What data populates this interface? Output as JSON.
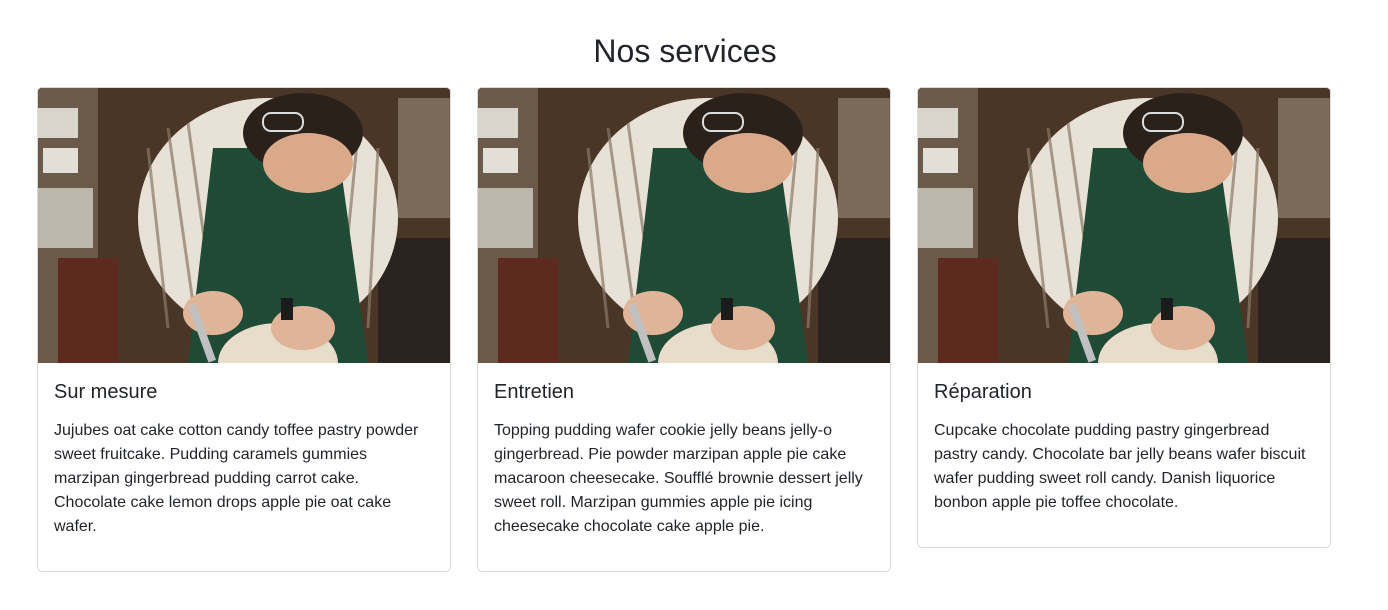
{
  "section": {
    "title": "Nos services"
  },
  "cards": [
    {
      "title": "Sur mesure",
      "text": "Jujubes oat cake cotton candy toffee pastry powder sweet fruitcake. Pudding caramels gummies marzipan gingerbread pudding carrot cake. Chocolate cake lemon drops apple pie oat cake wafer."
    },
    {
      "title": "Entretien",
      "text": "Topping pudding wafer cookie jelly beans jelly-o gingerbread. Pie powder marzipan apple pie cake macaroon cheesecake. Soufflé brownie dessert jelly sweet roll. Marzipan gummies apple pie icing cheesecake chocolate cake apple pie."
    },
    {
      "title": "Réparation",
      "text": "Cupcake chocolate pudding pastry gingerbread pastry candy. Chocolate bar jelly beans wafer biscuit wafer pudding sweet roll candy. Danish liquorice bonbon apple pie toffee chocolate."
    }
  ]
}
